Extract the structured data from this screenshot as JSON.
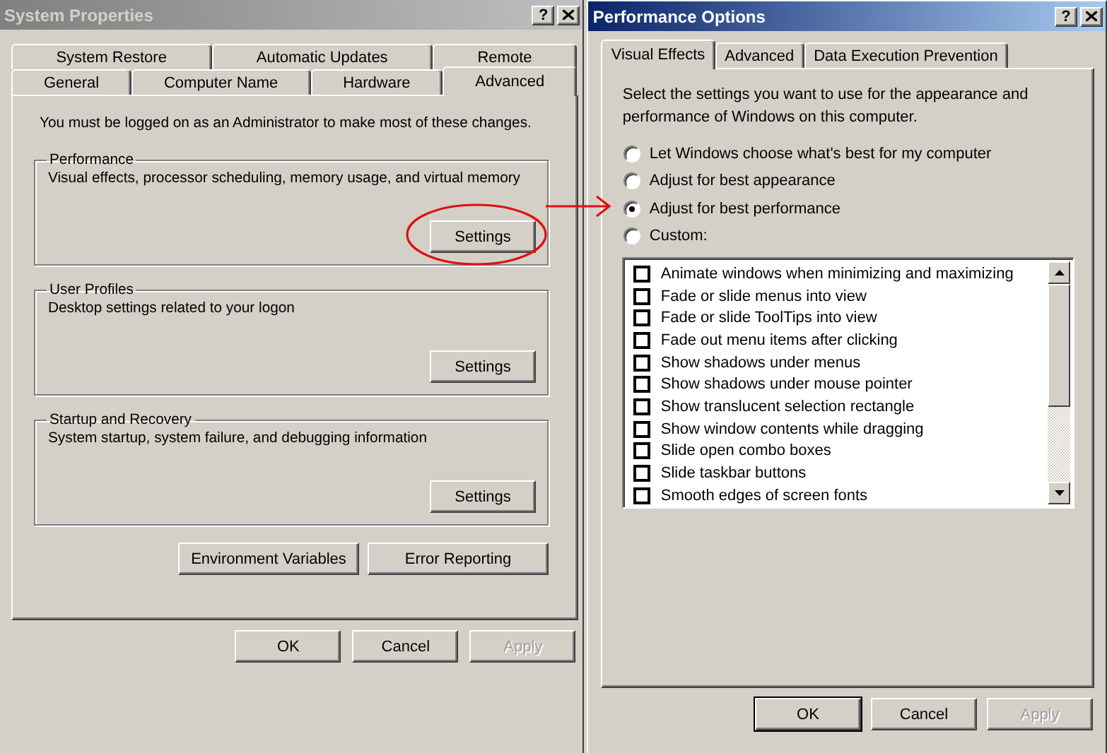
{
  "system_properties": {
    "title": "System Properties",
    "help_button": "?",
    "tab_rows": [
      [
        {
          "label": "System Restore",
          "selected": false
        },
        {
          "label": "Automatic Updates",
          "selected": false
        },
        {
          "label": "Remote",
          "selected": false
        }
      ],
      [
        {
          "label": "General",
          "selected": false
        },
        {
          "label": "Computer Name",
          "selected": false
        },
        {
          "label": "Hardware",
          "selected": false
        },
        {
          "label": "Advanced",
          "selected": true
        }
      ]
    ],
    "notice": "You must be logged on as an Administrator to make most of these changes.",
    "groups": [
      {
        "title": "Performance",
        "description": "Visual effects, processor scheduling, memory usage, and virtual memory",
        "button": "Settings"
      },
      {
        "title": "User Profiles",
        "description": "Desktop settings related to your logon",
        "button": "Settings"
      },
      {
        "title": "Startup and Recovery",
        "description": "System startup, system failure, and debugging information",
        "button": "Settings"
      }
    ],
    "extra_buttons": [
      "Environment Variables",
      "Error Reporting"
    ],
    "buttons": [
      {
        "label": "OK",
        "disabled": false,
        "default": false
      },
      {
        "label": "Cancel",
        "disabled": false,
        "default": false
      },
      {
        "label": "Apply",
        "disabled": true,
        "default": false
      }
    ]
  },
  "performance_options": {
    "title": "Performance Options",
    "help_button": "?",
    "tabs": [
      {
        "label": "Visual Effects",
        "selected": true
      },
      {
        "label": "Advanced",
        "selected": false
      },
      {
        "label": "Data Execution Prevention",
        "selected": false
      }
    ],
    "intro": "Select the settings you want to use for the appearance and performance of Windows on this computer.",
    "options": [
      {
        "label": "Let Windows choose what's best for my computer",
        "selected": false
      },
      {
        "label": "Adjust for best appearance",
        "selected": false
      },
      {
        "label": "Adjust for best performance",
        "selected": true
      },
      {
        "label": "Custom:",
        "selected": false
      }
    ],
    "effects": [
      {
        "label": "Animate windows when minimizing and maximizing",
        "checked": false
      },
      {
        "label": "Fade or slide menus into view",
        "checked": false
      },
      {
        "label": "Fade or slide ToolTips into view",
        "checked": false
      },
      {
        "label": "Fade out menu items after clicking",
        "checked": false
      },
      {
        "label": "Show shadows under menus",
        "checked": false
      },
      {
        "label": "Show shadows under mouse pointer",
        "checked": false
      },
      {
        "label": "Show translucent selection rectangle",
        "checked": false
      },
      {
        "label": "Show window contents while dragging",
        "checked": false
      },
      {
        "label": "Slide open combo boxes",
        "checked": false
      },
      {
        "label": "Slide taskbar buttons",
        "checked": false
      },
      {
        "label": "Smooth edges of screen fonts",
        "checked": false
      }
    ],
    "buttons": [
      {
        "label": "OK",
        "disabled": false,
        "default": true
      },
      {
        "label": "Cancel",
        "disabled": false,
        "default": false
      },
      {
        "label": "Apply",
        "disabled": true,
        "default": false
      }
    ]
  }
}
